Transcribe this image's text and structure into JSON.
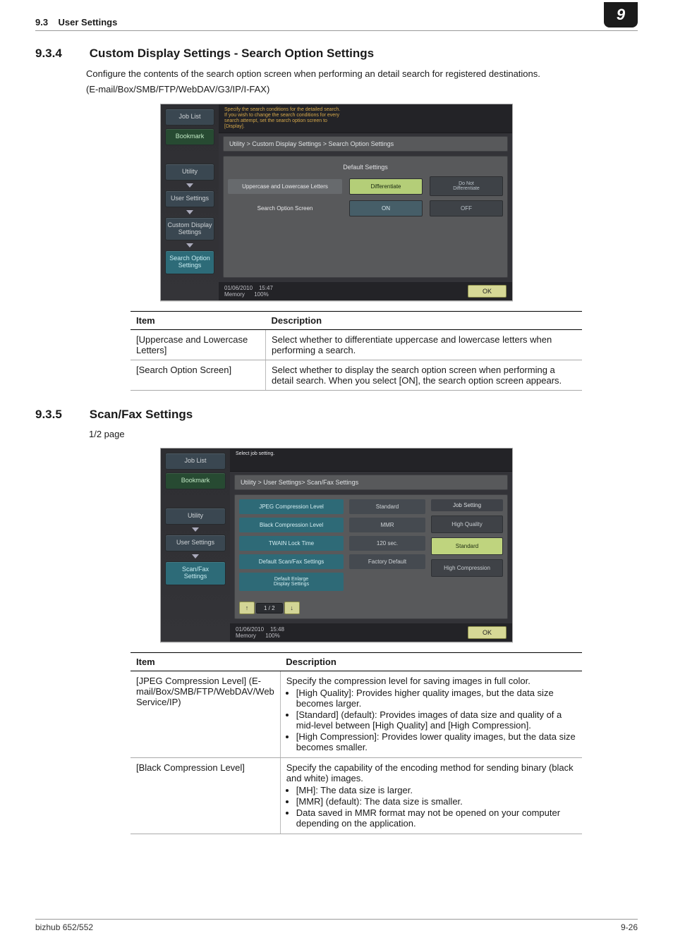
{
  "header": {
    "section_no": "9.3",
    "section_title": "User Settings",
    "corner": "9"
  },
  "s934": {
    "num": "9.3.4",
    "title": "Custom Display Settings - Search Option Settings",
    "para1": "Configure the contents of the search option screen when performing an detail search for registered destinations.",
    "para2": "(E-mail/Box/SMB/FTP/WebDAV/G3/IP/I-FAX)"
  },
  "shot1": {
    "sidebar": {
      "job_list": "Job List",
      "bookmark": "Bookmark",
      "utility": "Utility",
      "user_settings": "User Settings",
      "custom": "Custom Display\nSettings",
      "search_opt": "Search Option\nSettings"
    },
    "topnote": "Specify the search conditions for the detailed search.\nIf you wish to change the search conditions for every\nsearch attempt, set the search option screen to\n[Display].",
    "crumb": "Utility > Custom Display Settings > Search Option Settings",
    "default_settings": "Default Settings",
    "row1": {
      "label": "Uppercase and Lowercase Letters",
      "opt1": "Differentiate",
      "opt2": "Do Not\nDifferentiate"
    },
    "row2": {
      "label": "Search Option Screen",
      "opt1": "ON",
      "opt2": "OFF"
    },
    "footer_date": "01/06/2010",
    "footer_time": "15:47",
    "footer_mem": "Memory",
    "footer_pct": "100%",
    "ok": "OK"
  },
  "table1": {
    "h1": "Item",
    "h2": "Description",
    "rows": [
      {
        "item": "[Uppercase and Lowercase Letters]",
        "desc": "Select whether to differentiate uppercase and lowercase letters when performing a search."
      },
      {
        "item": "[Search Option Screen]",
        "desc": "Select whether to display the search option screen when performing a detail search. When you select [ON], the search option screen appears."
      }
    ]
  },
  "s935": {
    "num": "9.3.5",
    "title": "Scan/Fax Settings",
    "sub": "1/2 page"
  },
  "shot2": {
    "sidebar": {
      "job_list": "Job List",
      "bookmark": "Bookmark",
      "utility": "Utility",
      "user_settings": "User Settings",
      "scanfax": "Scan/Fax\nSettings"
    },
    "topnote": "Select job setting.",
    "crumb": "Utility > User Settings> Scan/Fax Settings",
    "right_title": "Job Setting",
    "right_btns": [
      "High Quality",
      "Standard",
      "High Compression"
    ],
    "rows": [
      {
        "label": "JPEG Compression Level",
        "val": "Standard"
      },
      {
        "label": "Black Compression Level",
        "val": "MMR"
      },
      {
        "label": "TWAIN Lock Time",
        "val": "120   sec."
      },
      {
        "label": "Default Scan/Fax Settings",
        "val": "Factory Default"
      },
      {
        "label": "Default Enlarge\nDisplay Settings",
        "val": ""
      }
    ],
    "pager": "1 / 2",
    "footer_date": "01/06/2010",
    "footer_time": "15:48",
    "footer_mem": "Memory",
    "footer_pct": "100%",
    "ok": "OK"
  },
  "table2": {
    "h1": "Item",
    "h2": "Description",
    "rows": [
      {
        "item": "[JPEG Compression Level] (E-mail/Box/SMB/FTP/WebDAV/Web Service/IP)",
        "desc": "Specify the compression level for saving images in full color.",
        "bullets": [
          "[High Quality]: Provides higher quality images, but the data size becomes larger.",
          "[Standard] (default): Provides images of data size and quality of a mid-level between [High Quality] and [High Compression].",
          "[High Compression]: Provides lower quality images, but the data size becomes smaller."
        ]
      },
      {
        "item": "[Black Compression Level]",
        "desc": "Specify the capability of the encoding method for sending binary (black and white) images.",
        "bullets": [
          "[MH]: The data size is larger.",
          "[MMR] (default): The data size is smaller.",
          "Data saved in MMR format may not be opened on your computer depending on the application."
        ]
      }
    ]
  },
  "pagefoot": {
    "left": "bizhub 652/552",
    "right": "9-26"
  },
  "chart_data": {
    "type": "table",
    "title": "Search Option Settings descriptions",
    "rows": []
  }
}
